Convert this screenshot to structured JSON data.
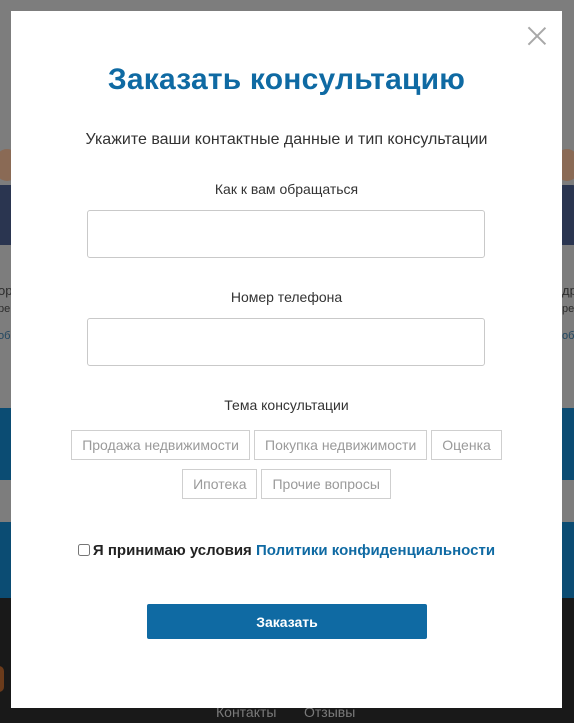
{
  "background": {
    "left_name_fragment": "ор",
    "left_role_fragment": "ре",
    "left_link_fragment": "об",
    "right_name_fragment": "др",
    "right_role_fragment": "ре",
    "right_link_fragment": "об",
    "footer_links": [
      "Контакты",
      "Отзывы"
    ]
  },
  "modal": {
    "title": "Заказать консультацию",
    "subtitle": "Укажите ваши контактные данные и тип консультации",
    "name_field": {
      "label": "Как к вам обращаться",
      "value": "",
      "placeholder": ""
    },
    "phone_field": {
      "label": "Номер телефона",
      "value": "",
      "placeholder": ""
    },
    "topic": {
      "label": "Тема консультации",
      "options": [
        "Продажа недвижимости",
        "Покупка недвижимости",
        "Оценка",
        "Ипотека",
        "Прочие вопросы"
      ]
    },
    "consent": {
      "checked": false,
      "text": "Я принимаю условия",
      "link": "Политики конфиденциальности"
    },
    "submit_label": "Заказать"
  },
  "colors": {
    "accent": "#0f6aa3",
    "overlay_blue": "#0b4c73",
    "footer": "#191919"
  }
}
